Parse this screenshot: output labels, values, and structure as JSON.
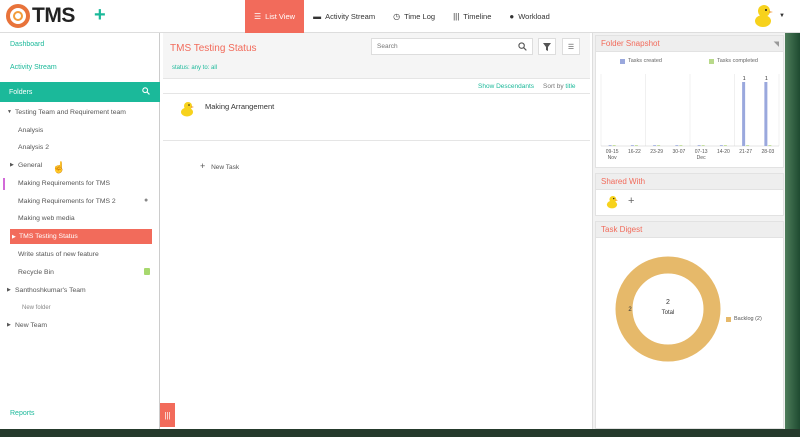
{
  "app": {
    "logo_text": "TMS"
  },
  "nav": {
    "items": [
      {
        "label": "List View",
        "icon": "list-icon"
      },
      {
        "label": "Activity Stream",
        "icon": "chat-icon"
      },
      {
        "label": "Time Log",
        "icon": "clock-icon"
      },
      {
        "label": "Timeline",
        "icon": "timeline-icon"
      },
      {
        "label": "Workload",
        "icon": "user-icon"
      }
    ]
  },
  "sidebar": {
    "dashboard": "Dashboard",
    "activity_stream": "Activity Stream",
    "folders": "Folders",
    "reports": "Reports",
    "tree": [
      {
        "label": "Testing Team and Requirement team"
      },
      {
        "label": "Analysis"
      },
      {
        "label": "Analysis 2"
      },
      {
        "label": "General"
      },
      {
        "label": "Making Requirements for TMS"
      },
      {
        "label": "Making Requirements for TMS 2"
      },
      {
        "label": "Making web media"
      },
      {
        "label": "TMS Testing Status"
      },
      {
        "label": "Write status of new feature"
      },
      {
        "label": "Recycle Bin"
      },
      {
        "label": "Santhoshkumar's Team"
      },
      {
        "label": "New folder"
      },
      {
        "label": "New Team"
      }
    ]
  },
  "main": {
    "title": "TMS Testing Status",
    "status_line": "status: any  to: all",
    "search_placeholder": "Search",
    "show_descendants": "Show Descendants",
    "sort_by_label": "Sort by",
    "sort_by_value": "title",
    "tasks": [
      {
        "name": "Making Arrangement"
      }
    ],
    "new_task": "New Task"
  },
  "folder_snapshot": {
    "title": "Folder Snapshot",
    "legend": [
      "Tasks created",
      "Tasks completed"
    ],
    "colors": {
      "created": "#9aa8dd",
      "completed": "#b8d98a"
    },
    "chart_data": {
      "type": "bar",
      "categories": [
        "09-15",
        "16-22",
        "23-29",
        "30-07",
        "07-13",
        "14-20",
        "21-27",
        "28-03"
      ],
      "category_sublabels": [
        "Nov",
        "",
        "",
        "",
        "Dec",
        "",
        "",
        ""
      ],
      "series": [
        {
          "name": "Tasks created",
          "values": [
            0,
            0,
            0,
            0,
            0,
            0,
            1,
            1
          ]
        },
        {
          "name": "Tasks completed",
          "values": [
            0,
            0,
            0,
            0,
            0,
            0,
            0,
            0
          ]
        }
      ],
      "data_labels": [
        "",
        "",
        "",
        "",
        "",
        "",
        "1",
        "1"
      ],
      "ylim": [
        0,
        1
      ]
    }
  },
  "shared_with": {
    "title": "Shared With"
  },
  "task_digest": {
    "title": "Task Digest",
    "total_value": "2",
    "total_label": "Total",
    "left_label": "2",
    "legend": "Backlog (2)",
    "chart_data": {
      "type": "pie",
      "categories": [
        "Backlog"
      ],
      "values": [
        2
      ]
    },
    "color": "#e6b96a"
  }
}
